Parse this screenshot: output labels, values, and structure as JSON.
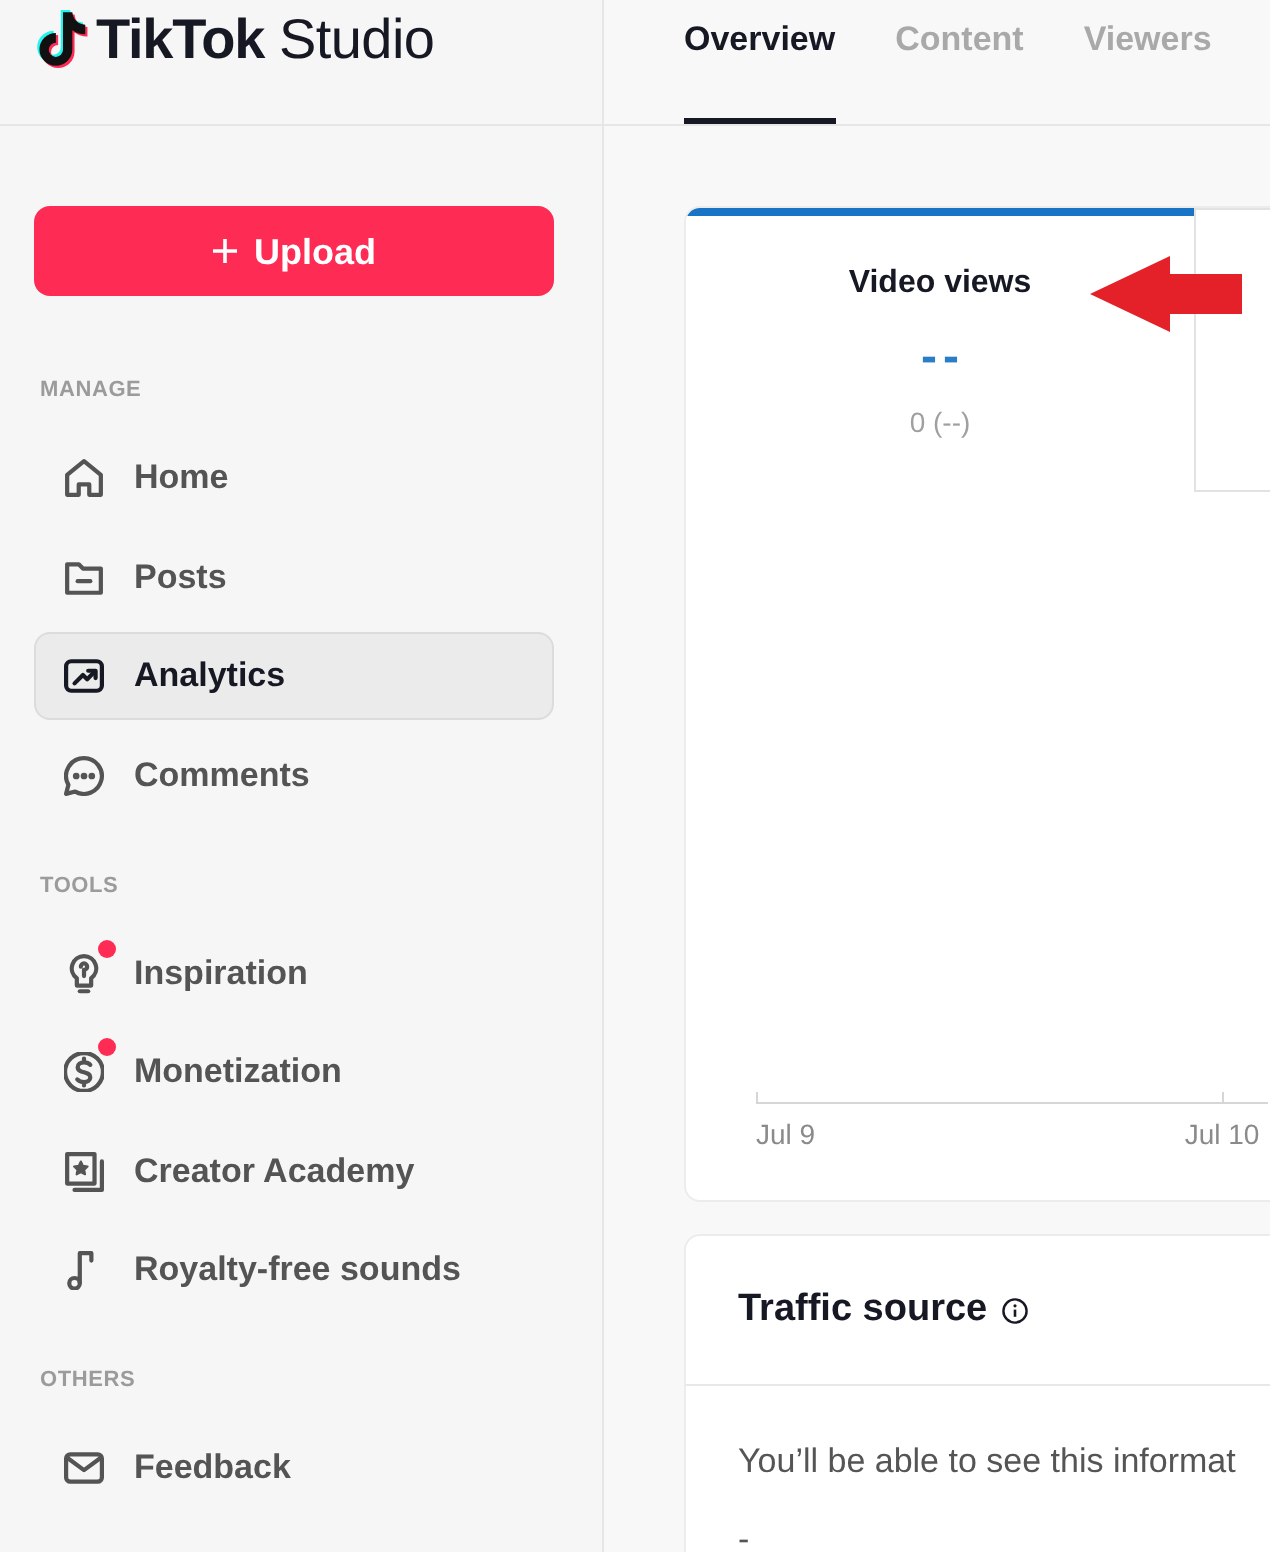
{
  "logo": {
    "wordmark": "**TikTok** Studio"
  },
  "upload_button": {
    "label": "Upload"
  },
  "sidebar": {
    "sections": [
      {
        "title": "MANAGE",
        "items": [
          {
            "label": "Home",
            "selected": false,
            "notification": false
          },
          {
            "label": "Posts",
            "selected": false,
            "notification": false
          },
          {
            "label": "Analytics",
            "selected": true,
            "notification": false
          },
          {
            "label": "Comments",
            "selected": false,
            "notification": false
          }
        ]
      },
      {
        "title": "TOOLS",
        "items": [
          {
            "label": "Inspiration",
            "selected": false,
            "notification": true
          },
          {
            "label": "Monetization",
            "selected": false,
            "notification": true
          },
          {
            "label": "Creator Academy",
            "selected": false,
            "notification": false
          },
          {
            "label": "Royalty-free sounds",
            "selected": false,
            "notification": false
          }
        ]
      },
      {
        "title": "OTHERS",
        "items": [
          {
            "label": "Feedback",
            "selected": false,
            "notification": false
          }
        ]
      }
    ]
  },
  "tabs": [
    {
      "label": "Overview",
      "selected": true
    },
    {
      "label": "Content",
      "selected": false
    },
    {
      "label": "Viewers",
      "selected": false
    }
  ],
  "overview_card": {
    "metrics": [
      {
        "title": "Video views",
        "value": "--",
        "change": "0 (--)",
        "selected": true
      },
      {
        "selected": false
      }
    ],
    "chart": {
      "x_labels": [
        "Jul 9",
        "Jul 10"
      ]
    }
  },
  "traffic_source": {
    "title": "Traffic source",
    "message": "You’ll be able to see this informat",
    "value": "-"
  }
}
